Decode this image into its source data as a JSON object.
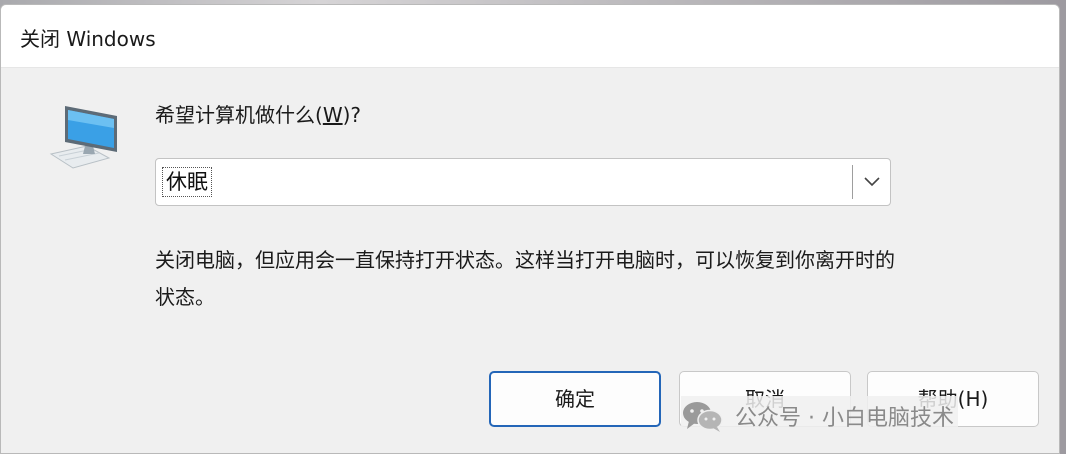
{
  "window": {
    "title": "关闭 Windows"
  },
  "prompt": {
    "text_before": "希望计算机做什么(",
    "accelerator": "W",
    "text_after": ")?"
  },
  "action_select": {
    "selected": "休眠"
  },
  "description": "关闭电脑，但应用会一直保持打开状态。这样当打开电脑时，可以恢复到你离开时的状态。",
  "buttons": {
    "ok_label": "确定",
    "cancel_label": "取消",
    "help_label": "帮助(H)"
  },
  "watermark": {
    "text": "公众号 · 小白电脑技术"
  },
  "icons": {
    "monitor": "computer-monitor-icon",
    "dropdown": "chevron-down-icon",
    "watermark": "wechat-icon"
  },
  "colors": {
    "dialog_bg": "#f0f0f0",
    "titlebar_bg": "#ffffff",
    "default_button_border": "#2466b8"
  }
}
